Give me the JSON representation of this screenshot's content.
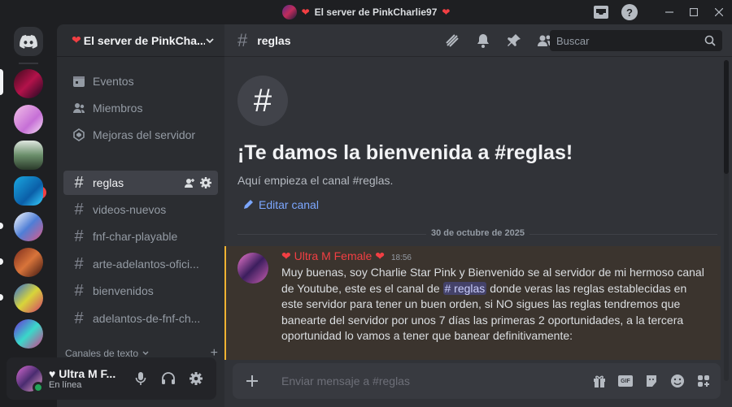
{
  "window": {
    "title": "El server de PinkCharlie97",
    "title_heart_left": "❤",
    "title_heart_right": "❤",
    "help": "?"
  },
  "rail": {
    "badge": "1"
  },
  "sidebar": {
    "server_name": "El server de PinkCha...",
    "heart": "❤",
    "items": [
      {
        "label": "Eventos",
        "icon": "calendar-icon"
      },
      {
        "label": "Miembros",
        "icon": "members-icon"
      },
      {
        "label": "Mejoras del servidor",
        "icon": "boost-icon"
      }
    ],
    "channels": [
      {
        "label": "reglas",
        "active": true
      },
      {
        "label": "videos-nuevos"
      },
      {
        "label": "fnf-char-playable"
      },
      {
        "label": "arte-adelantos-ofici..."
      },
      {
        "label": "bienvenidos"
      },
      {
        "label": "adelantos-de-fnf-ch..."
      }
    ],
    "category": "Canales de texto"
  },
  "user": {
    "name": "♥ Ultra M F...",
    "status": "En línea"
  },
  "channel": {
    "hash": "#",
    "name": "reglas",
    "search_placeholder": "Buscar"
  },
  "welcome": {
    "hash": "#",
    "title": "¡Te damos la bienvenida a #reglas!",
    "subtitle": "Aquí empieza el canal #reglas.",
    "edit": "Editar canal"
  },
  "date_divider": "30 de octubre de 2025",
  "message": {
    "author": "❤ Ultra M Female ❤",
    "time": "18:56",
    "text_before": "Muy buenas, soy Charlie Star Pink y Bienvenido se al servidor de mi hermoso canal de Youtube, este es el canal de ",
    "mention": "# reglas",
    "text_after": " donde veras las reglas establecidas en este servidor para tener un buen orden, si NO sigues las reglas tendremos que banearte del servidor por unos 7 días las primeras 2 oportunidades, a la tercera oportunidad lo vamos a tener que banear definitivamente:"
  },
  "composer": {
    "placeholder": "Enviar mensaje a #reglas",
    "gif": "GIF"
  },
  "colors": {
    "accent": "#5865f2",
    "online": "#23a55a",
    "mention_bar": "#f0b232",
    "author": "#f23f43"
  }
}
